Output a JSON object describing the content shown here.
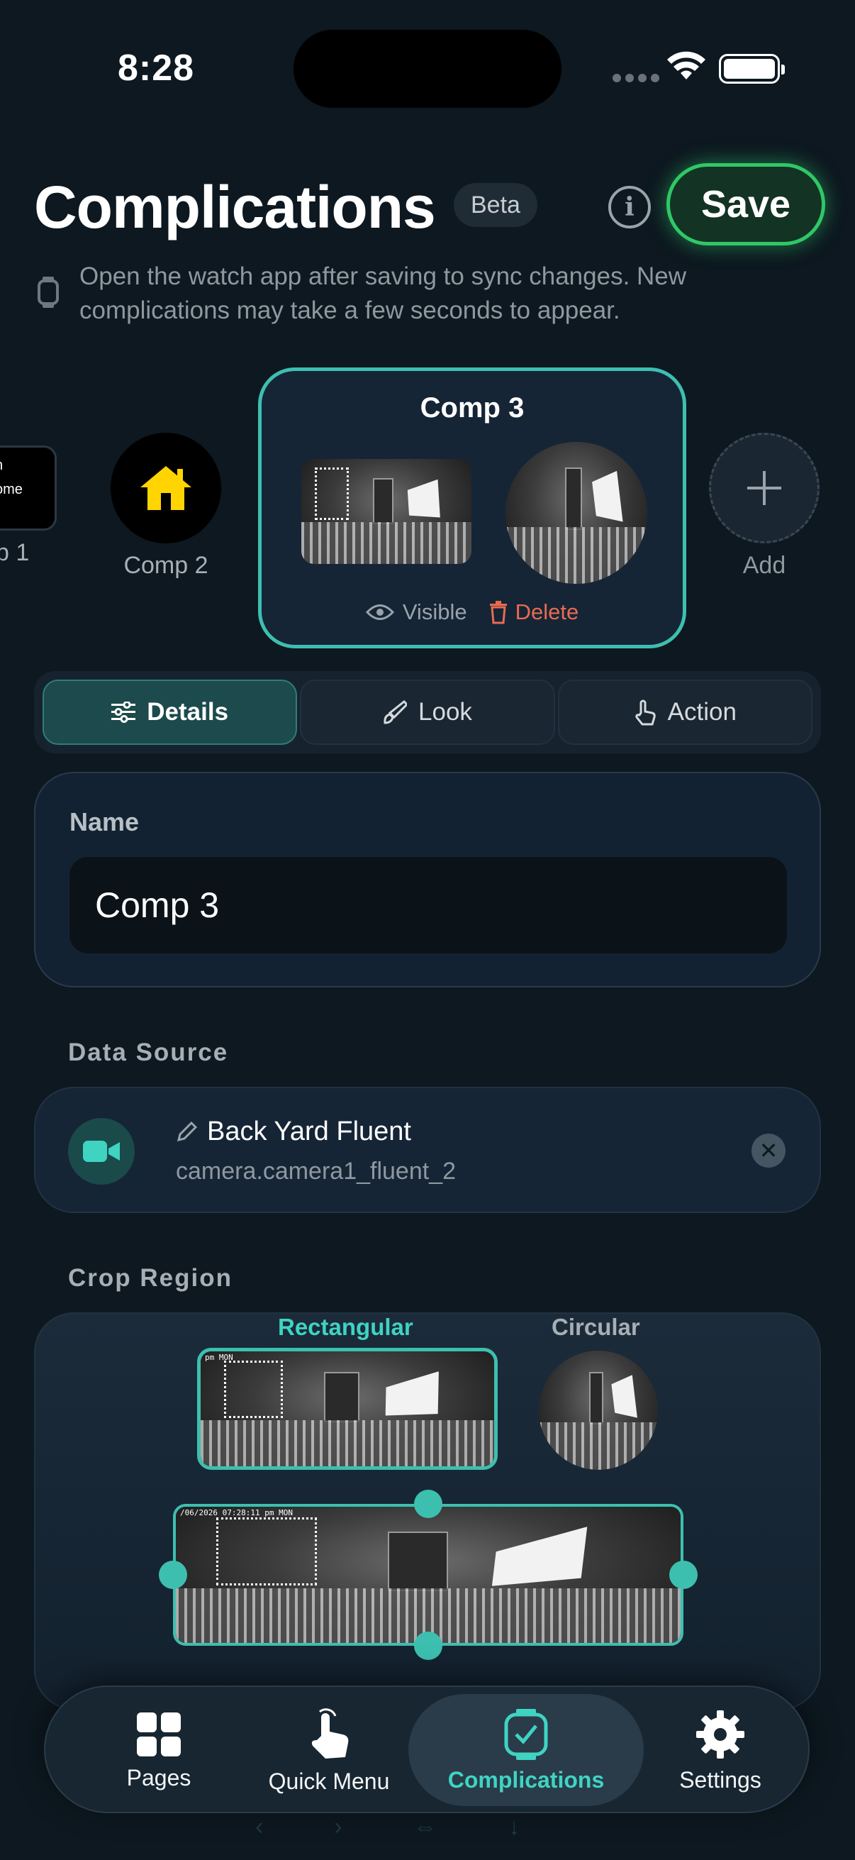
{
  "status_bar": {
    "time": "8:28"
  },
  "header": {
    "title": "Complications",
    "badge": "Beta",
    "save_label": "Save",
    "note": "Open the watch app after saving to sync changes. New complications may take a few seconds to appear."
  },
  "complications": [
    {
      "label": "p 1",
      "preview_text": [
        "n",
        "ome"
      ]
    },
    {
      "label": "Comp 2"
    },
    {
      "label": "Comp 3",
      "selected": true,
      "visible_label": "Visible",
      "delete_label": "Delete"
    }
  ],
  "add_label": "Add",
  "tabs": [
    {
      "label": "Details",
      "active": true
    },
    {
      "label": "Look",
      "active": false
    },
    {
      "label": "Action",
      "active": false
    }
  ],
  "name_field": {
    "label": "Name",
    "value": "Comp 3"
  },
  "data_source": {
    "heading": "Data Source",
    "name": "Back Yard Fluent",
    "entity": "camera.camera1_fluent_2"
  },
  "crop_region": {
    "heading": "Crop Region",
    "tab_rect": "Rectangular",
    "tab_circle": "Circular",
    "stamp_small": "pm MON",
    "stamp_full": "/06/2026 07:28:11 pm MON"
  },
  "nav": {
    "items": [
      {
        "label": "Pages"
      },
      {
        "label": "Quick Menu"
      },
      {
        "label": "Complications",
        "active": true
      },
      {
        "label": "Settings"
      }
    ]
  },
  "colors": {
    "accent": "#3dbfb0",
    "save_green": "#2fc866",
    "delete_red": "#e86a50",
    "home_yellow": "#ffd400",
    "background": "#0d1820"
  }
}
